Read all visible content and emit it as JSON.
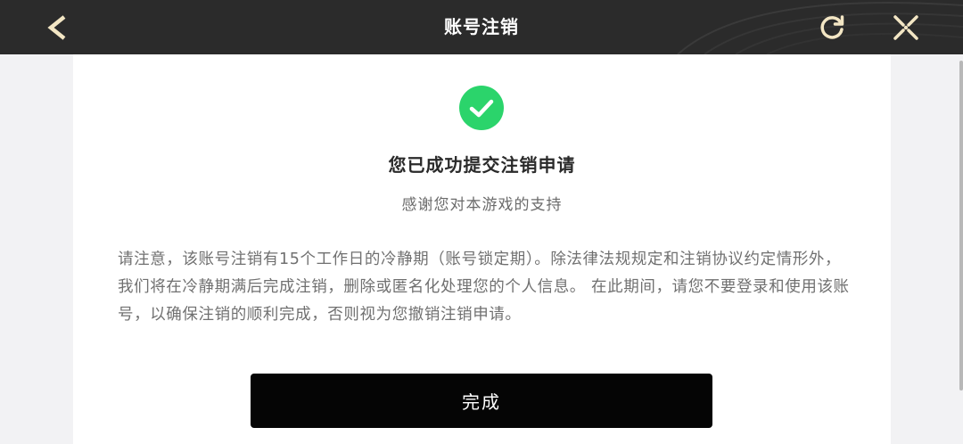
{
  "header": {
    "title": "账号注销",
    "back_icon": "chevron-left-icon",
    "refresh_icon": "refresh-icon",
    "close_icon": "close-icon",
    "bar_color": "#2b2b2b",
    "icon_color": "#f3e6c4"
  },
  "content": {
    "status_icon": "check-circle-icon",
    "status_color": "#2bd46b",
    "headline": "您已成功提交注销申请",
    "subline": "感谢您对本游戏的支持",
    "notice": "请注意，该账号注销有15个工作日的冷静期（账号锁定期）。除法律法规规定和注销协议约定情形外，我们将在冷静期满后完成注销，删除或匿名化处理您的个人信息。 在此期间，请您不要登录和使用该账号，以确保注销的顺利完成，否则视为您撤销注销申请。"
  },
  "actions": {
    "done_label": "完成",
    "done_color": "#050505"
  }
}
